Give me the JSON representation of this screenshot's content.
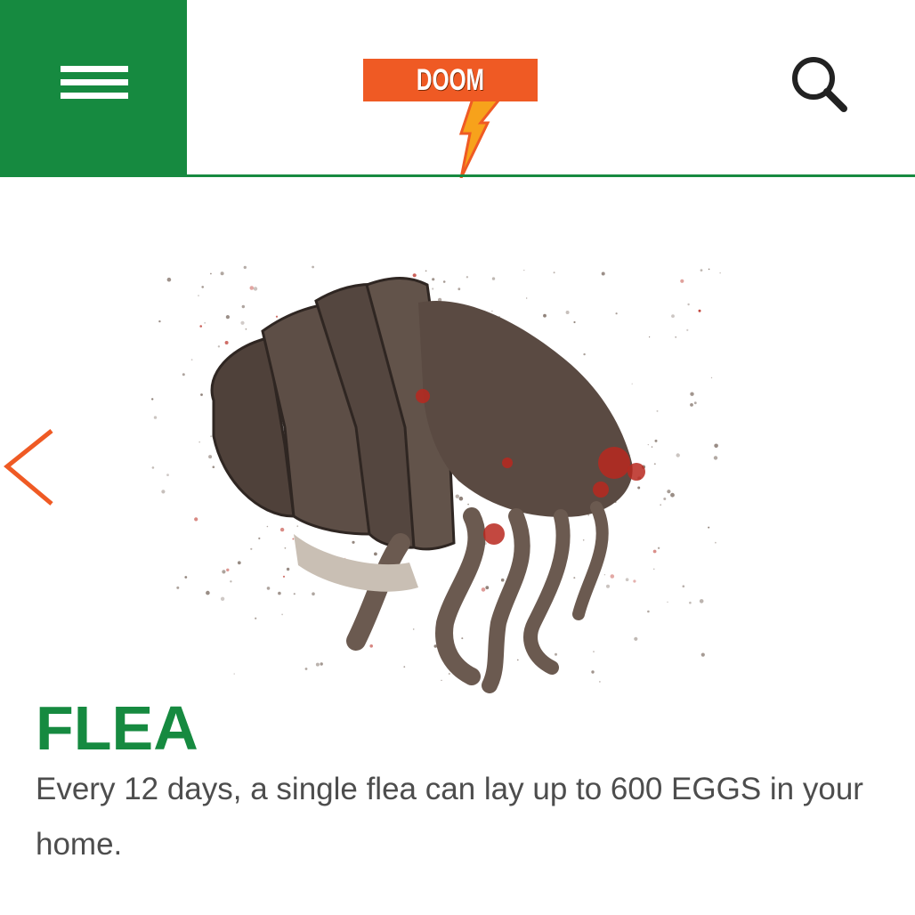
{
  "colors": {
    "brand_green": "#168a40",
    "brand_orange": "#ef5a24",
    "bolt_yellow": "#f7a21b",
    "text_gray": "#4d4d4d",
    "flea_brown": "#5a4a42",
    "blood_red": "#b8281e"
  },
  "header": {
    "menu_icon": "hamburger-menu-icon",
    "logo": {
      "text": "DOOM"
    },
    "search_icon": "magnifier-search-icon"
  },
  "carousel": {
    "prev_icon": "chevron-left-icon",
    "image_subject": "flea"
  },
  "content": {
    "title": "FLEA",
    "description": "Every 12 days, a single flea can lay up to 600 EGGS in your home."
  }
}
